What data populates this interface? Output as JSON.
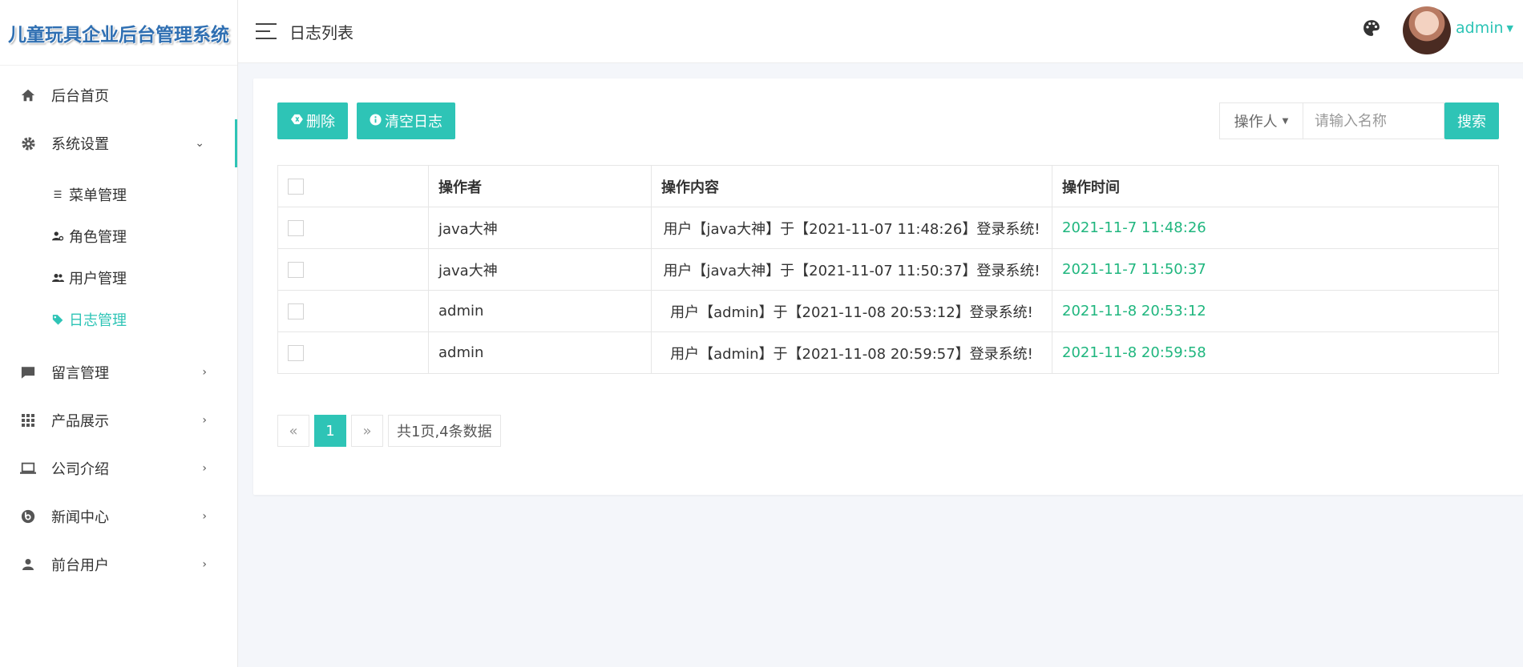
{
  "app": {
    "title": "儿童玩具企业后台管理系统"
  },
  "sidebar": {
    "items": [
      {
        "label": "后台首页",
        "icon": "home-icon"
      },
      {
        "label": "系统设置",
        "icon": "gear-icon",
        "open": true,
        "children": [
          {
            "label": "菜单管理",
            "icon": "list-icon"
          },
          {
            "label": "角色管理",
            "icon": "user-cog-icon"
          },
          {
            "label": "用户管理",
            "icon": "users-icon"
          },
          {
            "label": "日志管理",
            "icon": "tags-icon",
            "active": true
          }
        ]
      },
      {
        "label": "留言管理",
        "icon": "comment-icon"
      },
      {
        "label": "产品展示",
        "icon": "grid-icon"
      },
      {
        "label": "公司介绍",
        "icon": "laptop-icon"
      },
      {
        "label": "新闻中心",
        "icon": "beats-icon"
      },
      {
        "label": "前台用户",
        "icon": "user-icon"
      }
    ]
  },
  "header": {
    "title": "日志列表",
    "username": "admin"
  },
  "toolbar": {
    "delete_label": "删除",
    "clear_label": "清空日志"
  },
  "search": {
    "field_label": "操作人",
    "placeholder": "请输入名称",
    "button_label": "搜索"
  },
  "table": {
    "headers": [
      "操作者",
      "操作内容",
      "操作时间"
    ],
    "rows": [
      {
        "operator": "java大神",
        "content": "用户【java大神】于【2021-11-07 11:48:26】登录系统!",
        "time": "2021-11-7 11:48:26"
      },
      {
        "operator": "java大神",
        "content": "用户【java大神】于【2021-11-07 11:50:37】登录系统!",
        "time": "2021-11-7 11:50:37"
      },
      {
        "operator": "admin",
        "content": "用户【admin】于【2021-11-08 20:53:12】登录系统!",
        "time": "2021-11-8 20:53:12"
      },
      {
        "operator": "admin",
        "content": "用户【admin】于【2021-11-08 20:59:57】登录系统!",
        "time": "2021-11-8 20:59:58"
      }
    ]
  },
  "pagination": {
    "prev": "«",
    "current": "1",
    "next": "»",
    "info": "共1页,4条数据"
  },
  "colors": {
    "accent": "#2ec4b6",
    "time_text": "#1fb67e"
  }
}
